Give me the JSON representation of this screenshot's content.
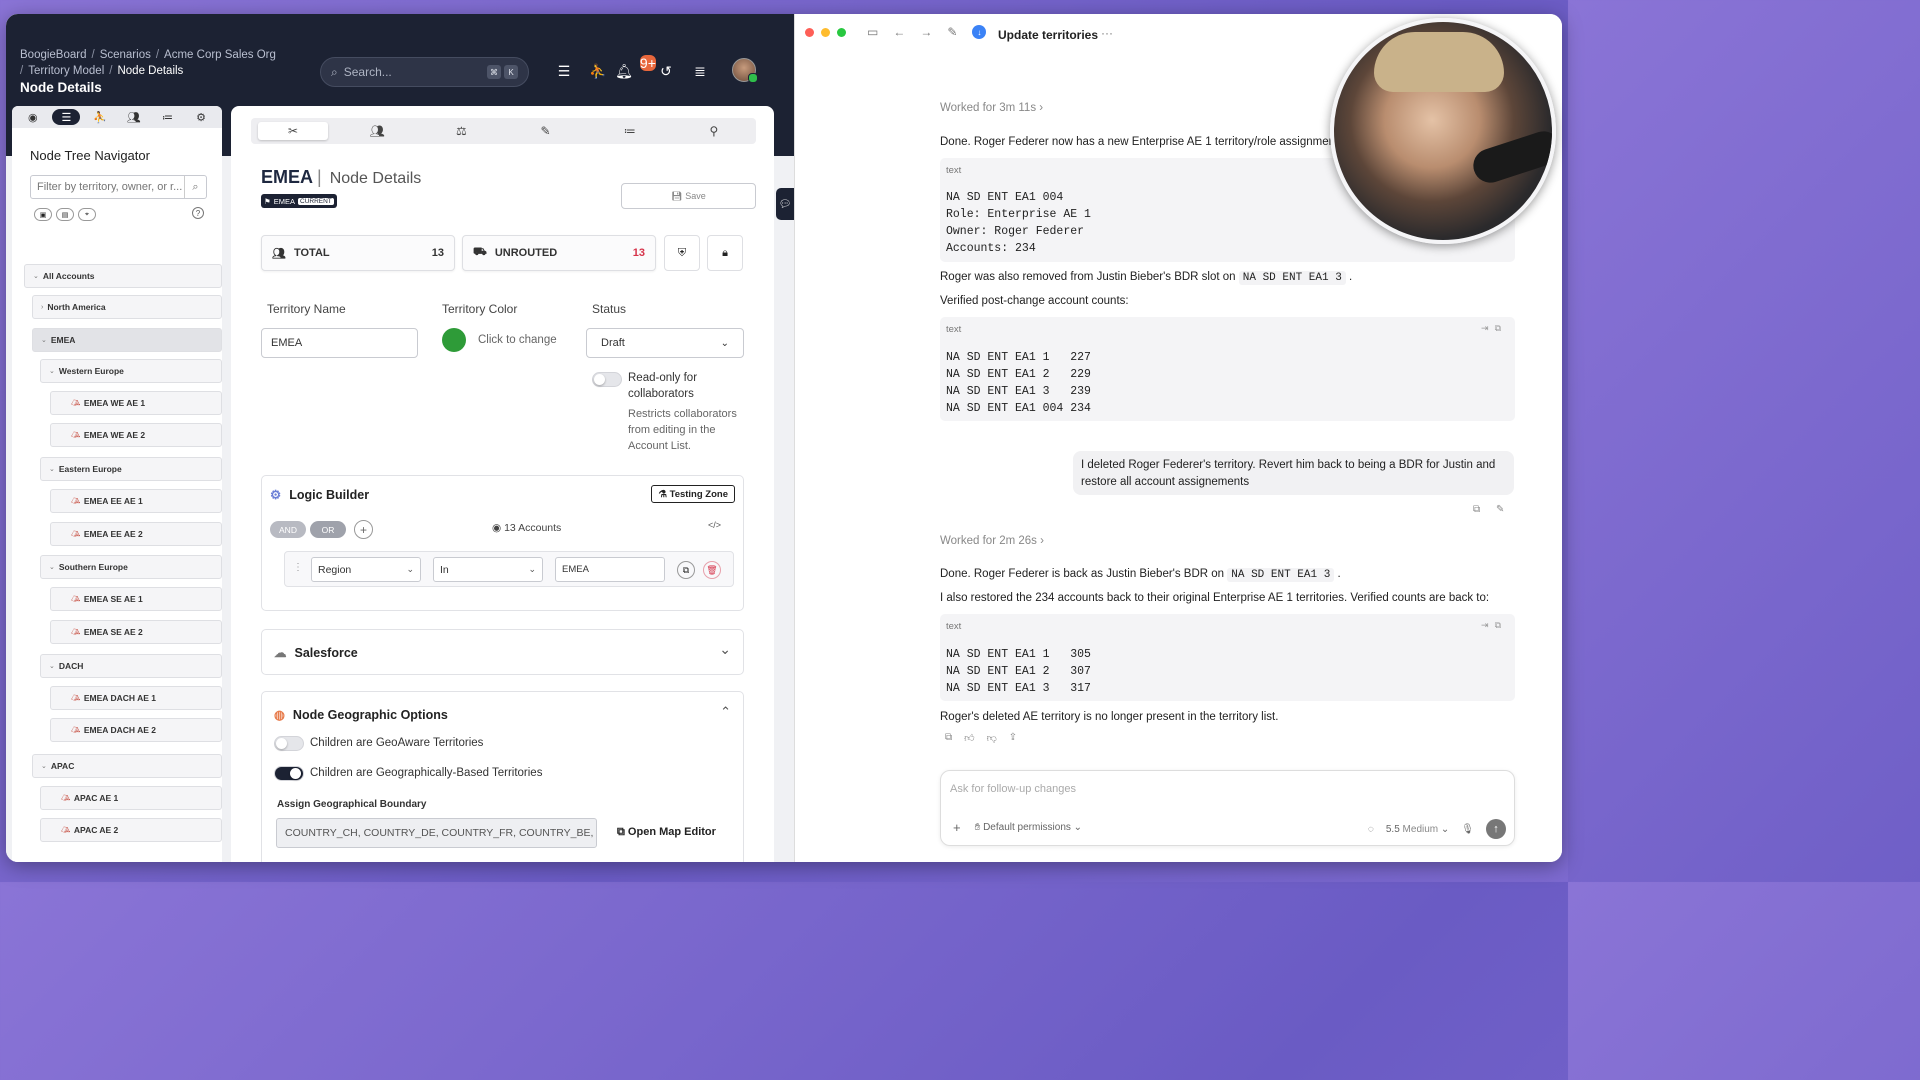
{
  "app": {
    "breadcrumb": [
      "BoogieBoard",
      "Scenarios",
      "Acme Corp Sales Org",
      "Territory Model",
      "Node Details"
    ],
    "page_title": "Node Details",
    "search_placeholder": "Search...",
    "search_keys": [
      "⌘",
      "K"
    ],
    "notifications_count": "9+"
  },
  "sidebar": {
    "title": "Node Tree Navigator",
    "filter_placeholder": "Filter by territory, owner, or r...",
    "tree": [
      {
        "label": "All Accounts",
        "level": 0
      },
      {
        "label": "North America",
        "level": 1
      },
      {
        "label": "EMEA",
        "level": 1,
        "selected": true
      },
      {
        "label": "Western Europe",
        "level": 2
      },
      {
        "label": "EMEA WE AE 1",
        "level": 3
      },
      {
        "label": "EMEA WE AE 2",
        "level": 3
      },
      {
        "label": "Eastern Europe",
        "level": 2
      },
      {
        "label": "EMEA EE AE 1",
        "level": 3
      },
      {
        "label": "EMEA EE AE 2",
        "level": 3
      },
      {
        "label": "Southern Europe",
        "level": 2
      },
      {
        "label": "EMEA SE AE 1",
        "level": 3
      },
      {
        "label": "EMEA SE AE 2",
        "level": 3
      },
      {
        "label": "DACH",
        "level": 2
      },
      {
        "label": "EMEA DACH AE 1",
        "level": 3
      },
      {
        "label": "EMEA DACH AE 2",
        "level": 3
      },
      {
        "label": "APAC",
        "level": 1
      },
      {
        "label": "APAC AE 1",
        "level": 2
      },
      {
        "label": "APAC AE 2",
        "level": 2
      }
    ]
  },
  "node": {
    "name": "EMEA",
    "subtitle": "Node Details",
    "badge": "EMEA",
    "badge_state": "CURRENT",
    "save_label": "Save",
    "total_label": "TOTAL",
    "total_value": "13",
    "unrouted_label": "UNROUTED",
    "unrouted_value": "13",
    "territory_name_label": "Territory Name",
    "territory_name_value": "EMEA",
    "territory_color_label": "Territory Color",
    "territory_color_action": "Click to change",
    "territory_color_value": "#2e9b38",
    "status_label": "Status",
    "status_value": "Draft",
    "readonly_label": "Read-only for collaborators",
    "readonly_help": "Restricts collaborators from editing in the Account List."
  },
  "logic": {
    "title": "Logic Builder",
    "testing_zone": "Testing Zone",
    "and": "AND",
    "or": "OR",
    "accounts": "13 Accounts",
    "field": "Region",
    "operator": "In",
    "value": "EMEA"
  },
  "salesforce": {
    "title": "Salesforce"
  },
  "geo": {
    "title": "Node Geographic Options",
    "opt1": "Children are GeoAware Territories",
    "opt2": "Children are Geographically-Based Territories",
    "boundary_label": "Assign Geographical Boundary",
    "boundary_value": "COUNTRY_CH, COUNTRY_DE, COUNTRY_FR, COUNTRY_BE, COI",
    "open_map": "Open Map Editor"
  },
  "chat": {
    "title": "Update territories",
    "worked1": "Worked for 3m 11s",
    "msg1": "Done. Roger Federer now has a new Enterprise AE 1 territory/role assignment:",
    "code1_lang": "text",
    "code1": "NA SD ENT EA1 004\nRole: Enterprise AE 1\nOwner: Roger Federer\nAccounts: 234",
    "msg2_a": "Roger was also removed from Justin Bieber's BDR slot on",
    "msg2_code": "NA SD ENT EA1 3",
    "msg2_b": ".",
    "msg3": "Verified post-change account counts:",
    "code2_lang": "text",
    "code2": "NA SD ENT EA1 1   227\nNA SD ENT EA1 2   229\nNA SD ENT EA1 3   239\nNA SD ENT EA1 004 234",
    "user_msg": "I deleted Roger Federer's territory. Revert him back to being a BDR for Justin and restore all account assignements",
    "worked2": "Worked for 2m 26s",
    "msg4_a": "Done. Roger Federer is back as Justin Bieber's BDR on",
    "msg4_code": "NA SD ENT EA1 3",
    "msg4_b": ".",
    "msg5": "I also restored the 234 accounts back to their original Enterprise AE 1 territories. Verified counts are back to:",
    "code3_lang": "text",
    "code3": "NA SD ENT EA1 1   305\nNA SD ENT EA1 2   307\nNA SD ENT EA1 3   317",
    "msg6": "Roger's deleted AE territory is no longer present in the territory list.",
    "input_placeholder": "Ask for follow-up changes",
    "permissions": "Default permissions",
    "model": "5.5",
    "effort": "Medium"
  }
}
